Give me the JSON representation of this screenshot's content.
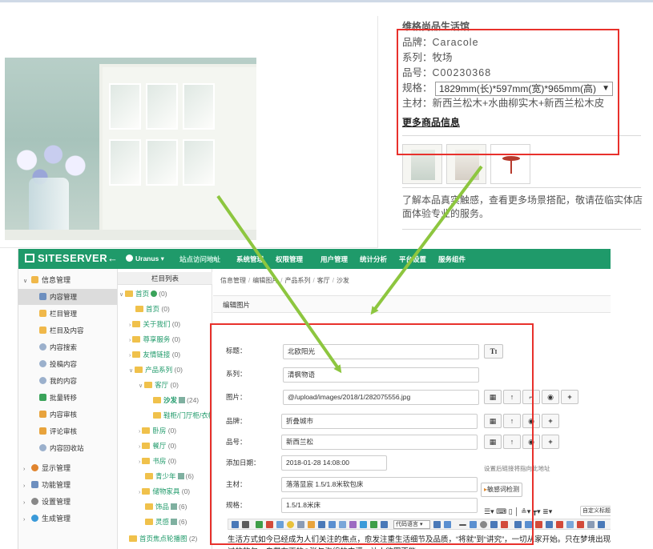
{
  "product": {
    "brand_title": "维格尚品生活馆",
    "specs": [
      {
        "key": "品牌：",
        "value": "Caracole"
      },
      {
        "key": "系列：",
        "value": "牧场"
      },
      {
        "key": "品号：",
        "value": "C00230368"
      }
    ],
    "size_label": "规格：",
    "size_selected": "1829mm(长)*597mm(宽)*965mm(高)",
    "material_label": "主材：",
    "material_value": "新西兰松木+水曲柳实木+新西兰松木皮",
    "more_link": "更多商品信息",
    "description": "了解本品真实触感，查看更多场景搭配，敬请莅临实体店面体验专业的服务。",
    "annotation_color": "#e8312c",
    "arrow_color": "#8dc63f"
  },
  "admin": {
    "brand": "SITESERVER",
    "back_icon": "arrow-left-icon",
    "site_menu": "Uranus",
    "nav": [
      "站点访问地址",
      "系统管理",
      "权限管理",
      "用户管理",
      "统计分析",
      "平台设置",
      "服务组件"
    ],
    "theme_color": "#1f9a6a",
    "sidebar": {
      "sections": [
        {
          "label": "信息管理",
          "items": [
            "内容管理",
            "栏目管理",
            "栏目及内容",
            "内容搜索",
            "投稿内容",
            "我的内容",
            "批量转移",
            "内容审核",
            "评论审核",
            "内容回收站"
          ]
        },
        {
          "label": "显示管理"
        },
        {
          "label": "功能管理"
        },
        {
          "label": "设置管理"
        },
        {
          "label": "生成管理"
        }
      ]
    },
    "tree": {
      "header": "栏目列表",
      "nodes": [
        {
          "name": "首页",
          "count": "(0)"
        },
        {
          "name": "首页",
          "count": "(0)"
        },
        {
          "name": "关于我们",
          "count": "(0)"
        },
        {
          "name": "尊享服务",
          "count": "(0)"
        },
        {
          "name": "友情链接",
          "count": "(0)"
        },
        {
          "name": "产品系列",
          "count": "(0)"
        },
        {
          "name": "客厅",
          "count": "(0)"
        },
        {
          "name": "沙发",
          "count": "(24)"
        },
        {
          "name": "鞋柜/门厅柜/衣帽",
          "count": ""
        },
        {
          "name": "卧房",
          "count": "(0)"
        },
        {
          "name": "餐厅",
          "count": "(0)"
        },
        {
          "name": "书房",
          "count": "(0)"
        },
        {
          "name": "青少年",
          "count": "(6)"
        },
        {
          "name": "储物家具",
          "count": "(0)"
        },
        {
          "name": "饰品",
          "count": "(6)"
        },
        {
          "name": "灵感",
          "count": "(6)"
        },
        {
          "name": "首页焦点轮播图",
          "count": "(2)"
        }
      ]
    },
    "breadcrumb": [
      "信息管理",
      "编辑图片",
      "产品系列",
      "客厅",
      "沙发"
    ],
    "panel_title": "编辑图片",
    "form": {
      "title_label": "标题：",
      "title_value": "北欧阳光",
      "series_label": "系列：",
      "series_value": "清枫物语",
      "image_label": "图片：",
      "image_value": "@/upload/images/2018/1/282075556.jpg",
      "brand_label": "品牌：",
      "brand_value": "折叠城市",
      "code_label": "品号：",
      "code_value": "新西兰松",
      "date_label": "添加日期：",
      "date_value": "2018-01-28 14:08:00",
      "material_label": "主材：",
      "material_value": "落落显宸 1.5/1.8米软包床",
      "size_label": "规格：",
      "size_value": "1.5/1.8米床",
      "link_hint": "设置后链接将指向此地址",
      "sensitive_button": "敏感词检测",
      "lang_select": "代码语言",
      "font_select": "自定义标题"
    },
    "editor_text": "生活方式如今已经成为人们关注的焦点，愈发注重生活细节及品质，“将就”到“讲究”，一切从家开始。只在梦境出现过的软包，自带布丁的Q弹与海绵的丰满，让人欲罢不能。"
  }
}
